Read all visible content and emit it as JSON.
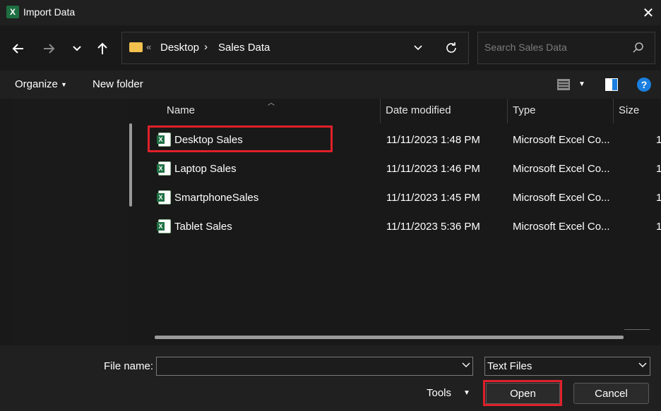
{
  "window": {
    "title": "Import Data",
    "close_glyph": "✕",
    "app_icon_letter": "X"
  },
  "nav": {
    "back_glyph": "🡐",
    "forward_glyph": "🡒",
    "recent_glyph": "⌄",
    "up_glyph": "🡑",
    "breadcrumb_more": "«",
    "breadcrumbs": [
      "Desktop",
      "Sales Data"
    ],
    "separator": "›",
    "address_dropdown_glyph": "⌄",
    "refresh_glyph": "↻"
  },
  "search": {
    "placeholder": "Search Sales Data"
  },
  "toolbar": {
    "organize_label": "Organize",
    "new_folder_label": "New folder",
    "help_glyph": "?"
  },
  "columns": {
    "name": "Name",
    "date_modified": "Date modified",
    "type": "Type",
    "size": "Size"
  },
  "files": [
    {
      "name": "Desktop Sales",
      "date": "11/11/2023 1:48 PM",
      "type": "Microsoft Excel Co...",
      "size": "1"
    },
    {
      "name": "Laptop Sales",
      "date": "11/11/2023 1:46 PM",
      "type": "Microsoft Excel Co...",
      "size": "1"
    },
    {
      "name": "SmartphoneSales",
      "date": "11/11/2023 1:45 PM",
      "type": "Microsoft Excel Co...",
      "size": "1"
    },
    {
      "name": "Tablet Sales",
      "date": "11/11/2023 5:36 PM",
      "type": "Microsoft Excel Co...",
      "size": "1"
    }
  ],
  "bottom": {
    "file_name_label": "File name:",
    "file_name_value": "",
    "file_type_value": "Text Files",
    "tools_label": "Tools",
    "open_label": "Open",
    "cancel_label": "Cancel"
  },
  "colors": {
    "highlight": "#e0202a",
    "background": "#202020",
    "excel_green": "#1d6f42",
    "folder": "#f2c14e",
    "help_blue": "#1a7fe0"
  }
}
